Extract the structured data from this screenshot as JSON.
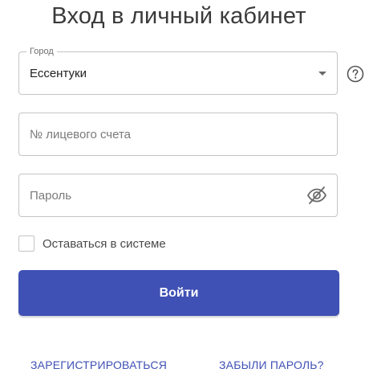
{
  "page": {
    "title": "Вход в личный кабинет"
  },
  "form": {
    "city": {
      "label": "Город",
      "value": "Ессентуки"
    },
    "account": {
      "placeholder": "№ лицевого счета"
    },
    "password": {
      "placeholder": "Пароль"
    },
    "remember": {
      "label": "Оставаться в системе",
      "checked": false
    },
    "submit_label": "Войти"
  },
  "links": {
    "register": "ЗАРЕГИСТРИРОВАТЬСЯ",
    "forgot_password": "ЗАБЫЛИ ПАРОЛЬ?"
  },
  "icons": {
    "city_dropdown": "chevron-down-icon",
    "help": "help-circle-icon",
    "password_visibility": "eye-off-icon"
  },
  "colors": {
    "accent": "#3f51b5",
    "border": "#c4c4c4",
    "text": "#212121"
  }
}
